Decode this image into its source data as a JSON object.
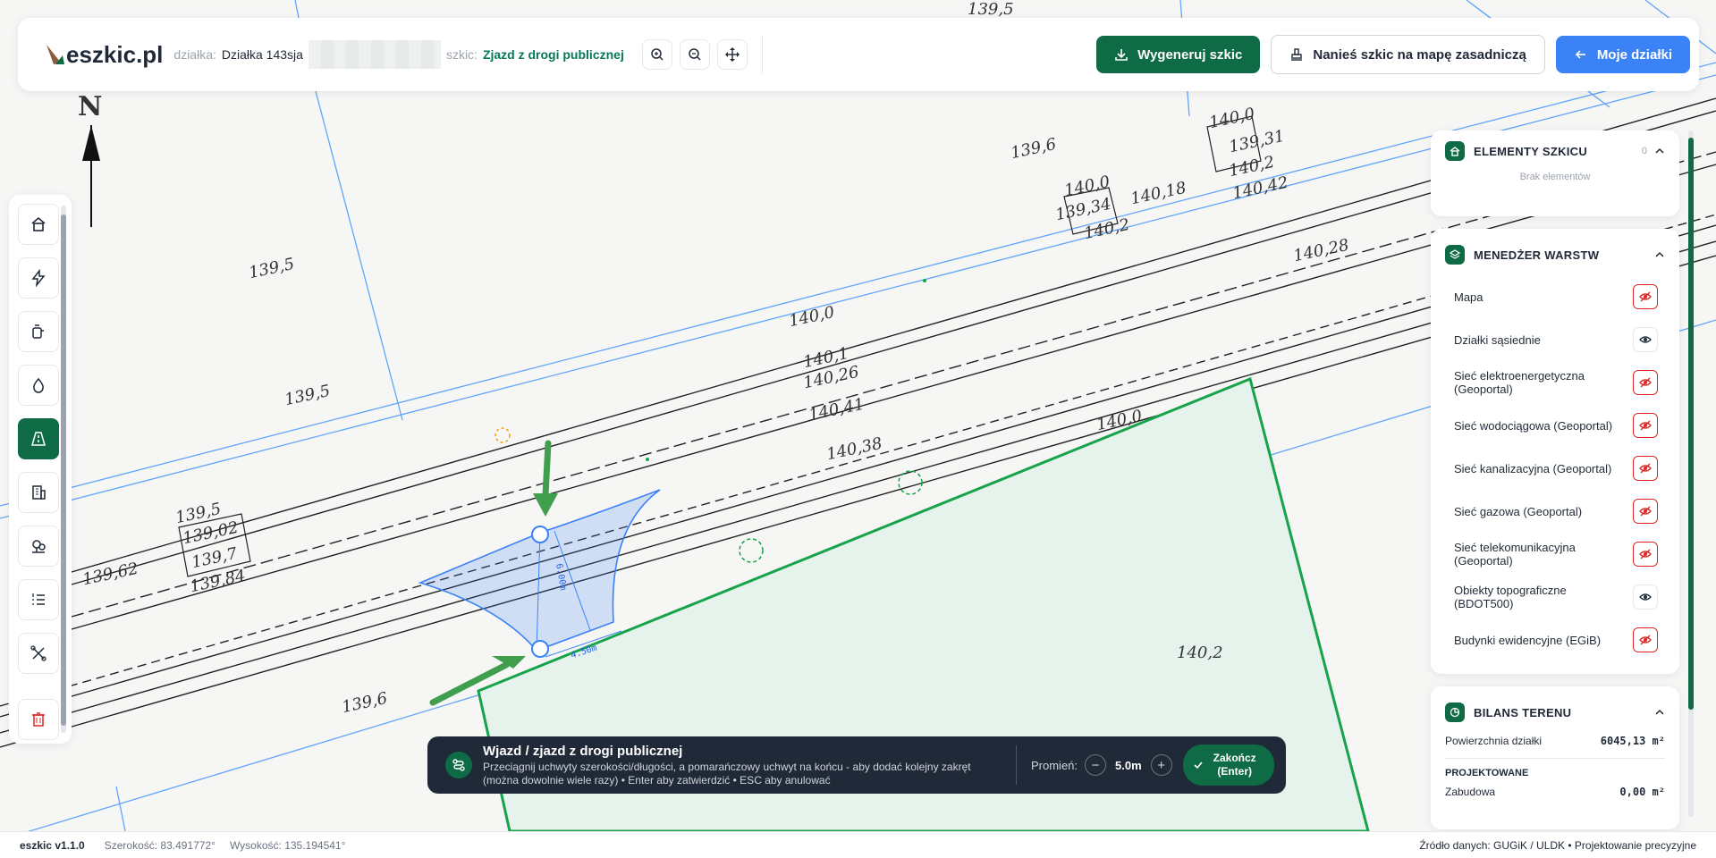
{
  "header": {
    "logo_text": "eszkic.pl",
    "parcel_label": "działka:",
    "parcel_value": "Działka 143sja",
    "sketch_label": "szkic:",
    "sketch_value": "Zjazd z drogi publicznej",
    "generate_label": "Wygeneruj szkic",
    "apply_label": "Nanieś szkic na mapę zasadniczą",
    "my_parcels_label": "Moje działki"
  },
  "map": {
    "north_label": "N",
    "labels": [
      {
        "text": "139,5"
      },
      {
        "text": "139,5"
      },
      {
        "text": "139,6"
      },
      {
        "text": "140,0"
      },
      {
        "text": "139,31"
      },
      {
        "text": "140,2"
      },
      {
        "text": "140,42"
      },
      {
        "text": "140,0"
      },
      {
        "text": "139,34"
      },
      {
        "text": "140,2"
      },
      {
        "text": "140,18"
      },
      {
        "text": "140,28"
      },
      {
        "text": "140,0"
      },
      {
        "text": "140,1"
      },
      {
        "text": "140,26"
      },
      {
        "text": "140,41"
      },
      {
        "text": "140,38"
      },
      {
        "text": "140,0"
      },
      {
        "text": "139,5"
      },
      {
        "text": "139,02"
      },
      {
        "text": "139,7"
      },
      {
        "text": "139,84"
      },
      {
        "text": "139,62"
      },
      {
        "text": "139,6"
      },
      {
        "text": "140,2"
      },
      {
        "text": "139,5"
      }
    ],
    "dim_width": "6.00m",
    "dim_length": "4.50m"
  },
  "sketch_elements": {
    "title": "ELEMENTY SZKICU",
    "count": "0",
    "empty_text": "Brak elementów"
  },
  "layers": {
    "title": "MENEDŻER WARSTW",
    "items": [
      {
        "label": "Mapa",
        "visible": false
      },
      {
        "label": "Działki sąsiednie",
        "visible": true
      },
      {
        "label": "Sieć elektroenergetyczna (Geoportal)",
        "visible": false
      },
      {
        "label": "Sieć wodociągowa (Geoportal)",
        "visible": false
      },
      {
        "label": "Sieć kanalizacyjna (Geoportal)",
        "visible": false
      },
      {
        "label": "Sieć gazowa (Geoportal)",
        "visible": false
      },
      {
        "label": "Sieć telekomunikacyjna (Geoportal)",
        "visible": false
      },
      {
        "label": "Obiekty topograficzne (BDOT500)",
        "visible": true
      },
      {
        "label": "Budynki ewidencyjne (EGiB)",
        "visible": false
      }
    ]
  },
  "balance": {
    "title": "BILANS TERENU",
    "area_label": "Powierzchnia działki",
    "area_value": "6045,13 m²",
    "projected_label": "PROJEKTOWANE",
    "building_label": "Zabudowa",
    "building_value": "0,00 m²"
  },
  "instruction": {
    "title": "Wjazd / zjazd z drogi publicznej",
    "description": "Przeciągnij uchwyty szerokości/długości, a pomarańczowy uchwyt na końcu - aby dodać kolejny zakręt (można dowolnie wiele razy) • Enter aby zatwierdzić • ESC aby anulować",
    "radius_label": "Promień:",
    "radius_value": "5.0m",
    "minus": "−",
    "plus": "+",
    "finish_label": "Zakończ (Enter)"
  },
  "footer": {
    "version": "eszkic v1.1.0",
    "latitude": "Szerokość: 83.491772°",
    "longitude": "Wysokość: 135.194541°",
    "source": "Źródło danych: GUGiK / ULDK • Projektowanie precyzyjne"
  },
  "colors": {
    "brand": "#0f6b45",
    "blue": "#3b82f6",
    "parcel": "#16a34a",
    "danger": "#dc2626"
  }
}
